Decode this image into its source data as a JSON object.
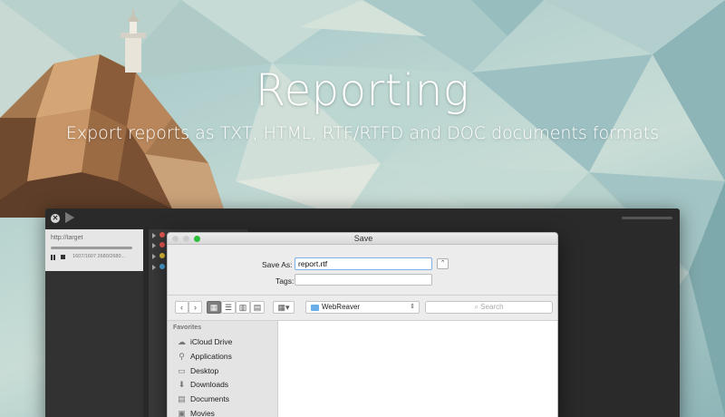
{
  "hero": {
    "title": "Reporting",
    "subtitle": "Export reports as TXT, HTML, RTF/RTFD and DOC documents formats"
  },
  "app": {
    "task_url": "http://target",
    "task_stats": "1607/1607  2680/2680..."
  },
  "dialog": {
    "title": "Save",
    "save_as_label": "Save As:",
    "save_as_value": "report.rtf",
    "tags_label": "Tags:",
    "tags_value": "",
    "location": "WebReaver",
    "search_placeholder": "Search",
    "sidebar": {
      "header": "Favorites",
      "items": [
        {
          "label": "iCloud Drive",
          "icon": "cloud-icon"
        },
        {
          "label": "Applications",
          "icon": "applications-icon"
        },
        {
          "label": "Desktop",
          "icon": "desktop-icon"
        },
        {
          "label": "Downloads",
          "icon": "downloads-icon"
        },
        {
          "label": "Documents",
          "icon": "documents-icon"
        },
        {
          "label": "Movies",
          "icon": "movies-icon"
        }
      ]
    }
  },
  "colors": {
    "accent_green": "#2dbf3c",
    "folder_blue": "#6aaee8",
    "focus_ring": "#7fb0ee",
    "dot_red": "#e0554d",
    "dot_yellow": "#e7c23a",
    "dot_blue": "#4aa7e0"
  }
}
